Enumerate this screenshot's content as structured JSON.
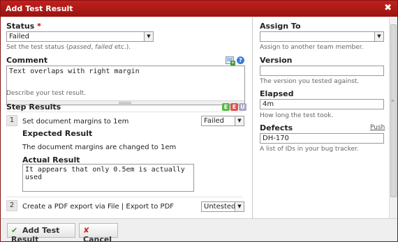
{
  "dialog": {
    "title": "Add Test Result"
  },
  "status": {
    "label": "Status",
    "required": "*",
    "value": "Failed",
    "hint_prefix": "Set the test status (",
    "hint_em1": "passed",
    "hint_mid": ", ",
    "hint_em2": "failed",
    "hint_suffix": " etc.)."
  },
  "comment": {
    "label": "Comment",
    "value": "Text overlaps with right margin",
    "hint": "Describe your test result."
  },
  "step_results": {
    "label": "Step Results",
    "badges": [
      "E",
      "E",
      "U"
    ],
    "steps": [
      {
        "number": "1",
        "description": "Set document margins to 1em",
        "status": "Failed",
        "expected_label": "Expected Result",
        "expected": "The document margins are changed to 1em",
        "actual_label": "Actual Result",
        "actual": "It appears that only 0.5em is actually used"
      },
      {
        "number": "2",
        "description": "Create a PDF export via File | Export to PDF",
        "status": "Untested"
      }
    ]
  },
  "assign_to": {
    "label": "Assign To",
    "value": "",
    "hint": "Assign to another team member."
  },
  "version": {
    "label": "Version",
    "value": "",
    "hint": "The version you tested against."
  },
  "elapsed": {
    "label": "Elapsed",
    "value": "4m",
    "hint": "How long the test took."
  },
  "defects": {
    "label": "Defects",
    "push": "Push",
    "value": "DH-170",
    "hint": "A list of IDs in your bug tracker."
  },
  "footer": {
    "submit": "Add Test Result",
    "cancel": "Cancel"
  },
  "colors": {
    "titlebar": "#b01a16",
    "badge_green": "#57b947",
    "badge_red": "#d9534f",
    "badge_grey": "#a7a7c4",
    "push_link": "#555555"
  }
}
